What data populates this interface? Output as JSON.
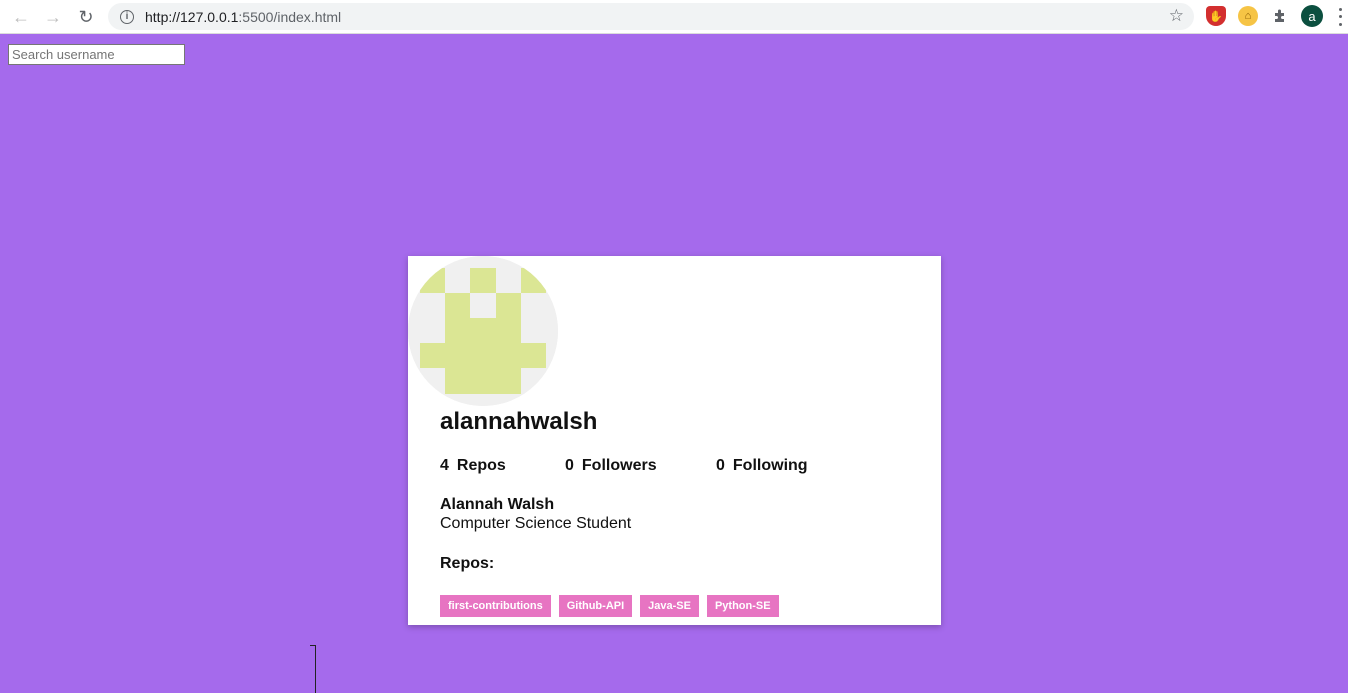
{
  "browser": {
    "url_host": "http://127.0.0.1",
    "url_path": ":5500/index.html",
    "profile_initial": "a",
    "icons": [
      "back-arrow-icon",
      "forward-arrow-icon",
      "reload-icon",
      "info-icon",
      "star-icon",
      "ublock-icon",
      "key-icon",
      "puzzle-icon",
      "menu-dots-icon"
    ]
  },
  "search": {
    "placeholder": "Search username",
    "value": ""
  },
  "profile": {
    "username": "alannahwalsh",
    "stats": [
      {
        "count": "4",
        "label": "Repos"
      },
      {
        "count": "0",
        "label": "Followers"
      },
      {
        "count": "0",
        "label": "Following"
      }
    ],
    "name": "Alannah Walsh",
    "bio": "Computer Science Student",
    "repos_heading": "Repos:",
    "repos": [
      "first-contributions",
      "Github-API",
      "Java-SE",
      "Python-SE"
    ]
  },
  "colors": {
    "page_background": "#a56aec",
    "card_background": "#ffffff",
    "repo_tag": "#e774c2",
    "avatar_identicon": "#dbe694",
    "avatar_background": "#f0f0f0"
  }
}
